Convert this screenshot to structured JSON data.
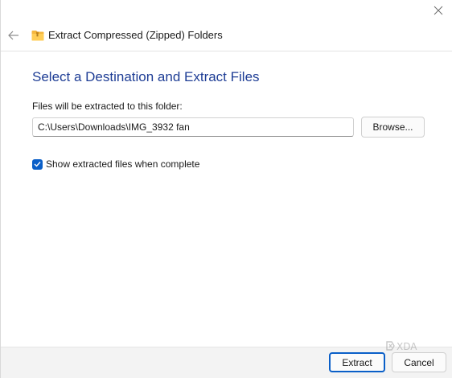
{
  "window": {
    "title": "Extract Compressed (Zipped) Folders"
  },
  "icons": {
    "close": "close-icon",
    "back": "back-arrow-icon",
    "folder": "zipped-folder-icon",
    "check": "checkmark-icon"
  },
  "content": {
    "heading": "Select a Destination and Extract Files",
    "folder_label": "Files will be extracted to this folder:",
    "path_value": "C:\\Users\\Downloads\\IMG_3932 fan",
    "browse_label": "Browse...",
    "show_files_label": "Show extracted files when complete",
    "show_files_checked": true
  },
  "footer": {
    "extract_label": "Extract",
    "cancel_label": "Cancel"
  },
  "colors": {
    "heading": "#1e3d95",
    "accent": "#0a5fc8",
    "footer_bg": "#f3f3f3"
  }
}
